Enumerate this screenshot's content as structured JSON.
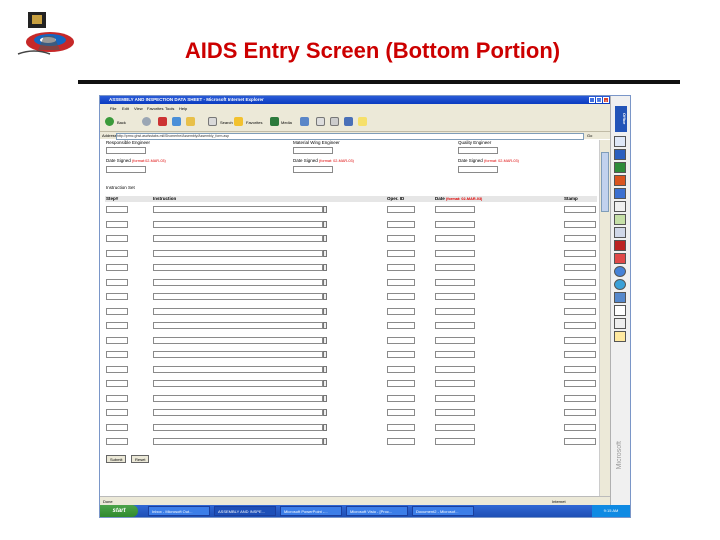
{
  "slide": {
    "title": "AIDS Entry Screen (Bottom Portion)",
    "logo_icon": "program-logo-icon"
  },
  "browser": {
    "window_title": "ASSEMBLY AND INSPECTION DATA SHEET - Microsoft Internet Explorer",
    "menu": [
      "File",
      "Edit",
      "View",
      "Favorites",
      "Tools",
      "Help"
    ],
    "toolbar": {
      "back": "Back",
      "search": "Search",
      "favorites": "Favorites",
      "media": "Media"
    },
    "address_label": "Address",
    "address_value": "http://prmc.ghst.ascfsstabs.mil/Shomerhe/Assembly/Assembly_form.asp",
    "go_label": "Go",
    "status_left": "Done",
    "status_right": "Internet",
    "sidebar_brand": "Office",
    "sidebar_vendor": "Microsoft"
  },
  "form": {
    "signatures": [
      {
        "role": "Responsible Engineer",
        "date_label": "Date Signed",
        "format": "(format:02-MAR-03)"
      },
      {
        "role": "Material Wing Engineer",
        "date_label": "Date Signed",
        "format": "(format: 02-MAR-03)"
      },
      {
        "role": "Quality Engineer",
        "date_label": "Date Signed",
        "format": "(format: 02-MAR-03)"
      }
    ],
    "section_label": "Instruction Set",
    "columns": {
      "step": "Step#",
      "instruction": "Instruction",
      "oper_id": "Oper. ID",
      "date": "Date",
      "date_format": "(format: 02-MAR-03)",
      "stamp": "Stamp"
    },
    "row_count": 17,
    "submit_label": "Submit",
    "reset_label": "Reset"
  },
  "taskbar": {
    "start_label": "start",
    "tasks": [
      "Inbox - Microsoft Out...",
      "ASSEMBLY AND INSPE...",
      "Microsoft PowerPoint -...",
      "Microsoft Visio - [Proc...",
      "Document2 - Microsof..."
    ],
    "clock": "9:15 AM"
  }
}
